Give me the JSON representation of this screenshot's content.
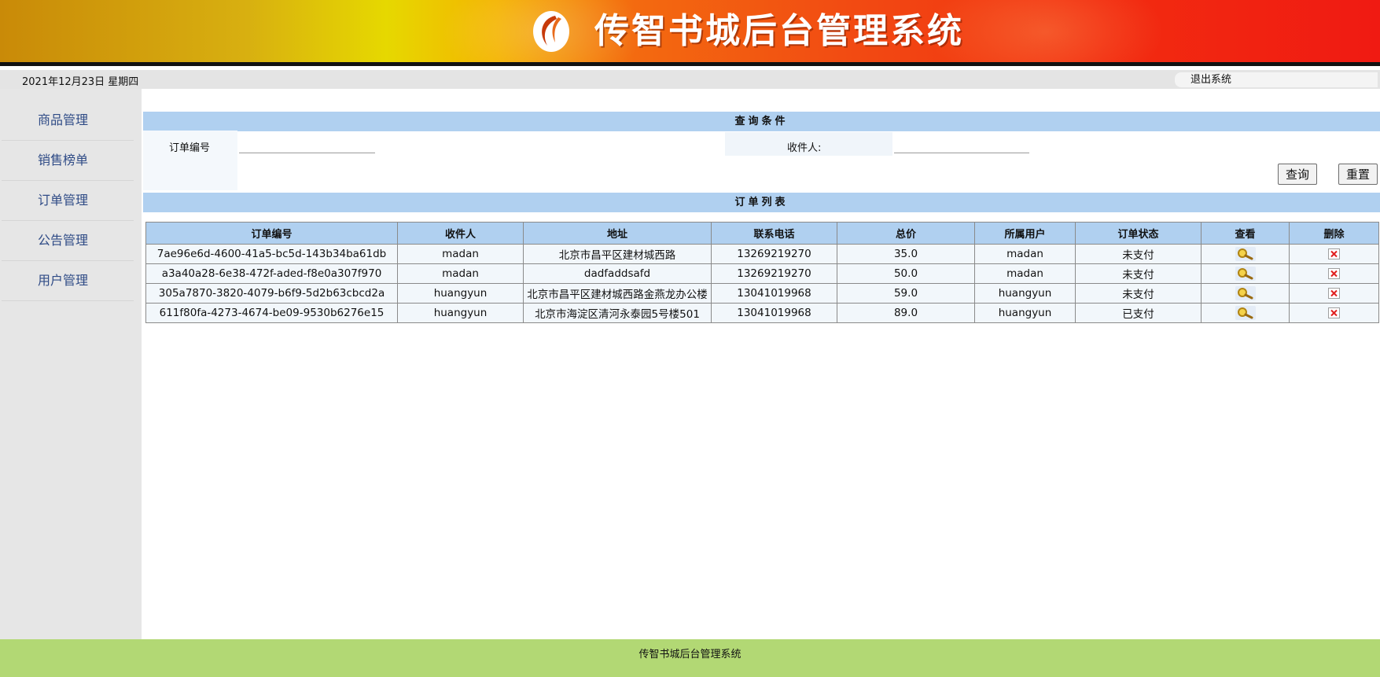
{
  "banner": {
    "title": "传智书城后台管理系统"
  },
  "topbar": {
    "date": "2021年12月23日 星期四",
    "logout": "退出系统"
  },
  "sidebar": {
    "items": [
      {
        "label": "商品管理"
      },
      {
        "label": "销售榜单"
      },
      {
        "label": "订单管理"
      },
      {
        "label": "公告管理"
      },
      {
        "label": "用户管理"
      }
    ]
  },
  "query": {
    "title": "查询条件",
    "order_id_label": "订单编号",
    "order_id_value": "",
    "receiver_label": "收件人:",
    "receiver_value": "",
    "search_button": "查询",
    "reset_button": "重置"
  },
  "orders": {
    "title": "订单列表",
    "columns": [
      "订单编号",
      "收件人",
      "地址",
      "联系电话",
      "总价",
      "所属用户",
      "订单状态",
      "查看",
      "删除"
    ],
    "rows": [
      {
        "id": "7ae96e6d-4600-41a5-bc5d-143b34ba61db",
        "receiver": "madan",
        "address": "北京市昌平区建材城西路",
        "phone": "13269219270",
        "total": "35.0",
        "user": "madan",
        "status": "未支付"
      },
      {
        "id": "a3a40a28-6e38-472f-aded-f8e0a307f970",
        "receiver": "madan",
        "address": "dadfaddsafd",
        "phone": "13269219270",
        "total": "50.0",
        "user": "madan",
        "status": "未支付"
      },
      {
        "id": "305a7870-3820-4079-b6f9-5d2b63cbcd2a",
        "receiver": "huangyun",
        "address": "北京市昌平区建材城西路金燕龙办公楼",
        "phone": "13041019968",
        "total": "59.0",
        "user": "huangyun",
        "status": "未支付"
      },
      {
        "id": "611f80fa-4273-4674-be09-9530b6276e15",
        "receiver": "huangyun",
        "address": "北京市海淀区清河永泰园5号楼501",
        "phone": "13041019968",
        "total": "89.0",
        "user": "huangyun",
        "status": "已支付"
      }
    ]
  },
  "footer": {
    "text": "传智书城后台管理系统"
  },
  "icons": {
    "logo": "swirl-logo-icon",
    "view": "magnifier-icon",
    "delete": "red-x-icon"
  },
  "colors": {
    "section_bar": "#b0d0f0",
    "footer": "#b2d874",
    "sidebar_link": "#2f4b86"
  }
}
